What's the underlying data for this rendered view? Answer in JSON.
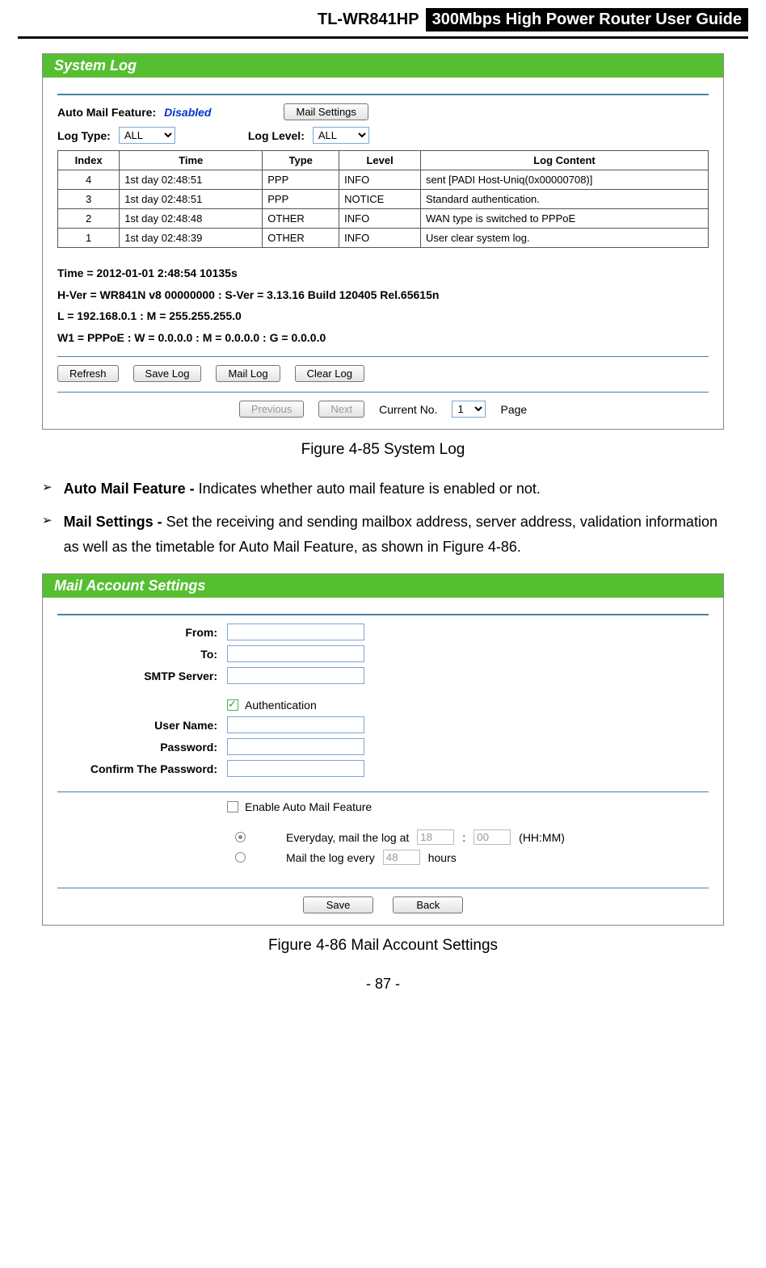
{
  "header": {
    "model": "TL-WR841HP",
    "tagline": "300Mbps High Power Router User Guide"
  },
  "system_log": {
    "title": "System Log",
    "auto_mail_label": "Auto Mail Feature:",
    "auto_mail_status": "Disabled",
    "mail_settings_btn": "Mail Settings",
    "log_type_label": "Log Type:",
    "log_type_value": "ALL",
    "log_level_label": "Log Level:",
    "log_level_value": "ALL",
    "columns": {
      "index": "Index",
      "time": "Time",
      "type": "Type",
      "level": "Level",
      "content": "Log Content"
    },
    "rows": [
      {
        "index": "4",
        "time": "1st day 02:48:51",
        "type": "PPP",
        "level": "INFO",
        "content": "sent [PADI Host-Uniq(0x00000708)]"
      },
      {
        "index": "3",
        "time": "1st day 02:48:51",
        "type": "PPP",
        "level": "NOTICE",
        "content": "Standard authentication."
      },
      {
        "index": "2",
        "time": "1st day 02:48:48",
        "type": "OTHER",
        "level": "INFO",
        "content": "WAN type is switched to PPPoE"
      },
      {
        "index": "1",
        "time": "1st day 02:48:39",
        "type": "OTHER",
        "level": "INFO",
        "content": "User clear system log."
      }
    ],
    "sys_info": [
      "Time = 2012-01-01 2:48:54 10135s",
      "H-Ver = WR841N v8 00000000 : S-Ver = 3.13.16 Build 120405 Rel.65615n",
      "L = 192.168.0.1 : M = 255.255.255.0",
      "W1 = PPPoE : W = 0.0.0.0 : M = 0.0.0.0 : G = 0.0.0.0"
    ],
    "buttons": {
      "refresh": "Refresh",
      "save": "Save Log",
      "mail": "Mail Log",
      "clear": "Clear Log"
    },
    "pager": {
      "prev": "Previous",
      "next": "Next",
      "current_label": "Current No.",
      "current_value": "1",
      "page": "Page"
    }
  },
  "caption_1": "Figure 4-85    System Log",
  "bullets": [
    {
      "term": "Auto Mail Feature - ",
      "desc": "Indicates whether auto mail feature is enabled or not."
    },
    {
      "term": "Mail Settings - ",
      "desc": "Set the receiving and sending mailbox address, server address, validation information as well as the timetable for Auto Mail Feature, as shown in Figure 4-86."
    }
  ],
  "mail": {
    "title": "Mail Account Settings",
    "labels": {
      "from": "From:",
      "to": "To:",
      "smtp": "SMTP Server:",
      "auth": "Authentication",
      "user": "User Name:",
      "pass": "Password:",
      "confirm": "Confirm The Password:",
      "enable": "Enable Auto Mail Feature"
    },
    "schedule": {
      "everyday_pre": "Everyday, mail the log at",
      "hh": "18",
      "mm": "00",
      "hhmm": "(HH:MM)",
      "every_pre": "Mail the log every",
      "every_val": "48",
      "every_post": "hours"
    },
    "buttons": {
      "save": "Save",
      "back": "Back"
    }
  },
  "caption_2": "Figure 4-86    Mail Account Settings",
  "page_footer": "- 87 -"
}
